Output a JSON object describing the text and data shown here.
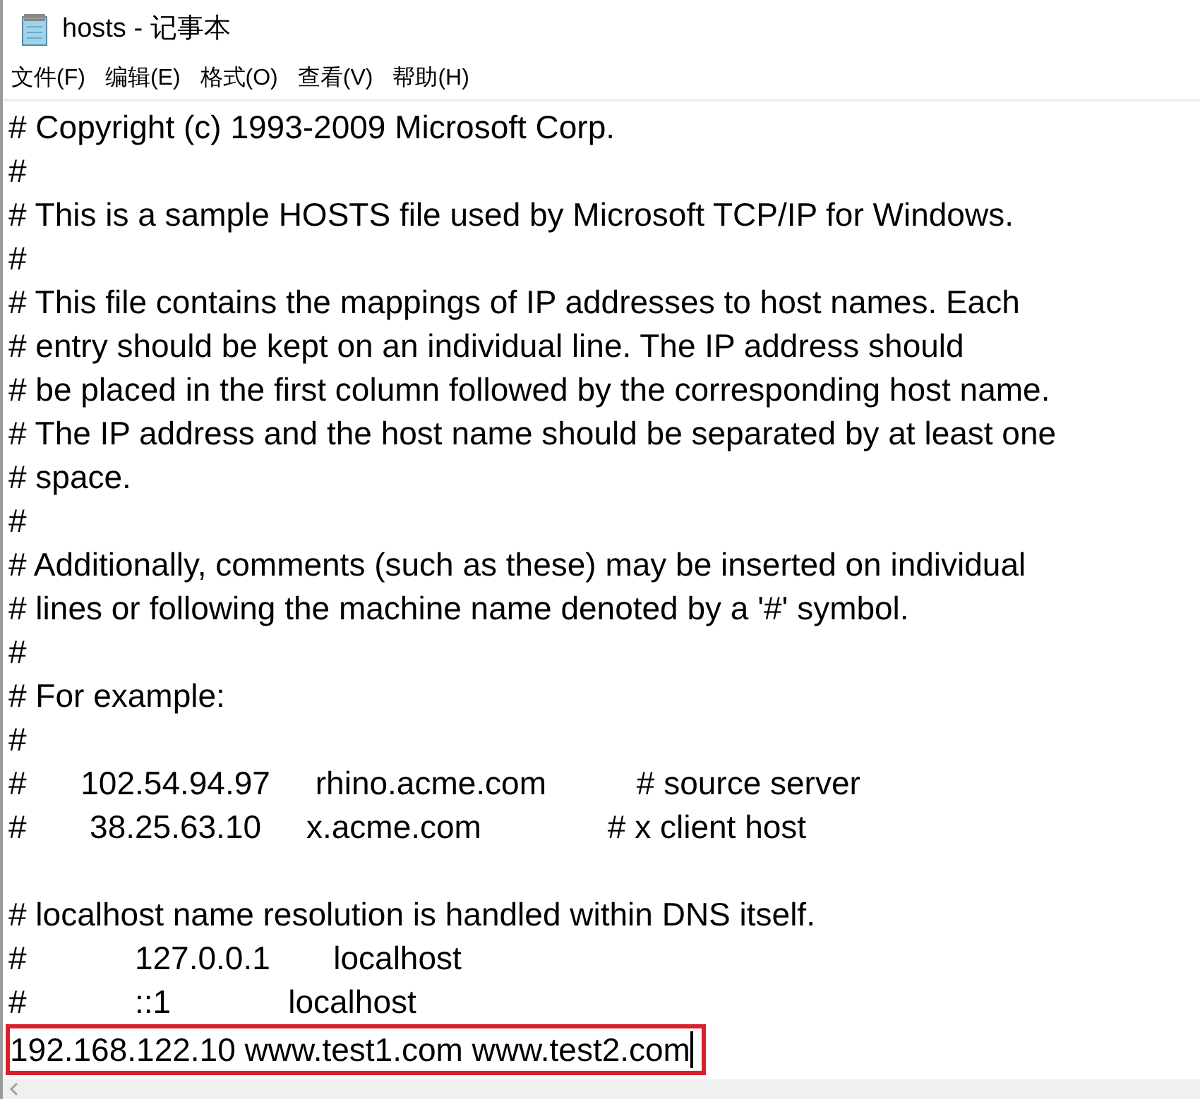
{
  "window": {
    "title": "hosts - 记事本"
  },
  "menu": [
    {
      "label": "文件(F)"
    },
    {
      "label": "编辑(E)"
    },
    {
      "label": "格式(O)"
    },
    {
      "label": "查看(V)"
    },
    {
      "label": "帮助(H)"
    }
  ],
  "lines": [
    {
      "text": "# Copyright (c) 1993-2009 Microsoft Corp."
    },
    {
      "text": "#"
    },
    {
      "text": "# This is a sample HOSTS file used by Microsoft TCP/IP for Windows."
    },
    {
      "text": "#"
    },
    {
      "text": "# This file contains the mappings of IP addresses to host names. Each"
    },
    {
      "text": "# entry should be kept on an individual line. The IP address should"
    },
    {
      "text": "# be placed in the first column followed by the corresponding host name."
    },
    {
      "text": "# The IP address and the host name should be separated by at least one"
    },
    {
      "text": "# space."
    },
    {
      "text": "#"
    },
    {
      "text": "# Additionally, comments (such as these) may be inserted on individual"
    },
    {
      "text": "# lines or following the machine name denoted by a '#' symbol."
    },
    {
      "text": "#"
    },
    {
      "text": "# For example:"
    },
    {
      "text": "#"
    },
    {
      "text": "#      102.54.94.97     rhino.acme.com          # source server"
    },
    {
      "text": "#       38.25.63.10     x.acme.com              # x client host"
    },
    {
      "text": "# localhost name resolution is handled within DNS itself.",
      "gap_before": true
    },
    {
      "text": "#            127.0.0.1       localhost"
    },
    {
      "text": "#            ::1             localhost"
    },
    {
      "text": "192.168.122.10 www.test1.com www.test2.com",
      "highlighted": true
    }
  ]
}
